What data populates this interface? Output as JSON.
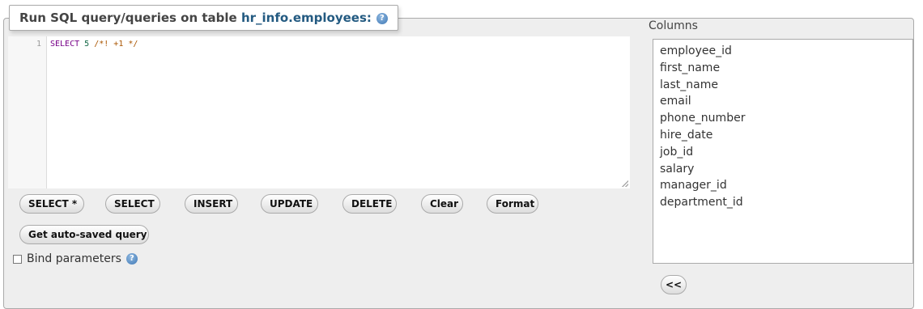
{
  "legend": {
    "prefix": "Run SQL query/queries on table ",
    "table": "hr_info.employees:",
    "help_icon": "help-icon"
  },
  "editor": {
    "line_number": "1",
    "code": {
      "kw": "SELECT",
      "num": "5",
      "comment": "/*! +1 */"
    }
  },
  "buttons": {
    "select_all": "SELECT *",
    "select": "SELECT",
    "insert": "INSERT",
    "update": "UPDATE",
    "delete": "DELETE",
    "clear": "Clear",
    "format": "Format",
    "auto_saved": "Get auto-saved query",
    "insert_column": "<<"
  },
  "bind_params": {
    "label": "Bind parameters",
    "checked": false
  },
  "columns": {
    "title": "Columns",
    "items": [
      "employee_id",
      "first_name",
      "last_name",
      "email",
      "phone_number",
      "hire_date",
      "job_id",
      "salary",
      "manager_id",
      "department_id"
    ]
  }
}
